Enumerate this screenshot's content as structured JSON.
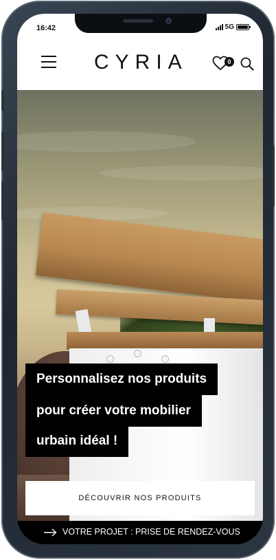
{
  "status_bar": {
    "time": "16:42",
    "network": "5G",
    "battery_level": 1.0
  },
  "header": {
    "logo": "CYRIA",
    "wishlist_count": "0",
    "icons": [
      "menu-icon",
      "heart-icon",
      "search-icon"
    ]
  },
  "hero": {
    "headline_lines": [
      "Personnalisez nos produits",
      "pour créer votre mobilier",
      "urbain idéal !"
    ],
    "cta_label": "DÉCOUVRIR NOS PRODUITS"
  },
  "bottom_bar": {
    "label": "VOTRE PROJET : PRISE DE RENDEZ-VOUS",
    "icon": "arrow-right-icon"
  },
  "colors": {
    "accent": "#000000",
    "background": "#ffffff",
    "text_on_dark": "#ffffff"
  }
}
